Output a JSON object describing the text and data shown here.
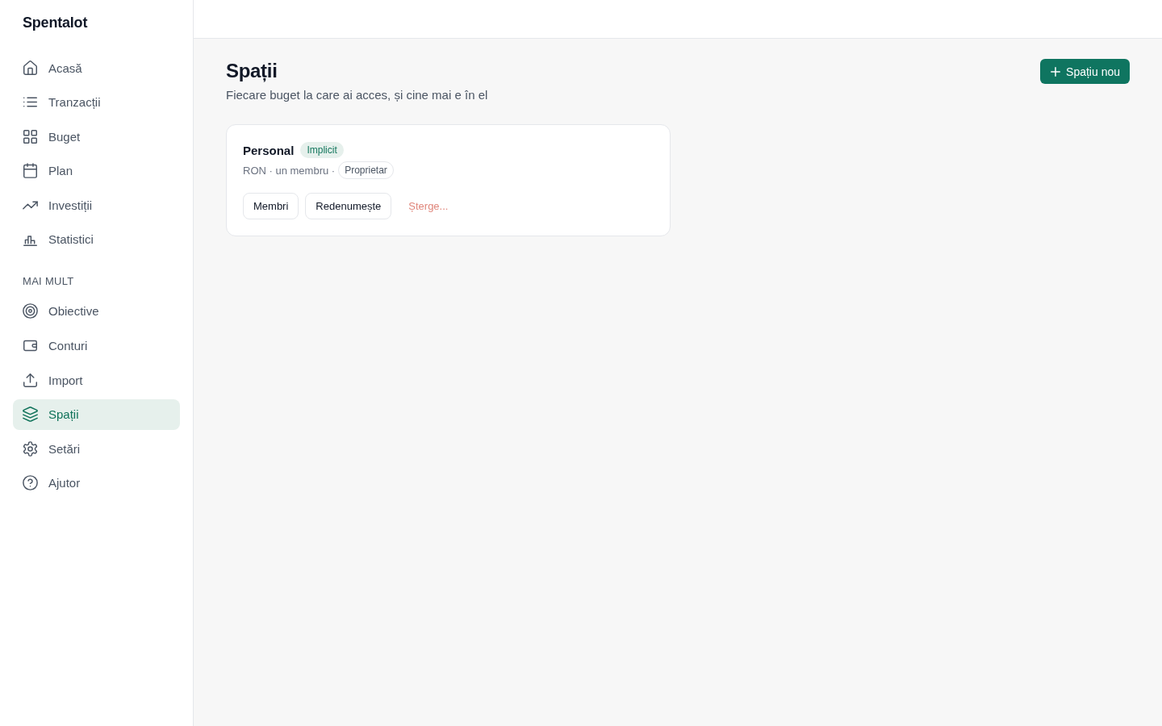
{
  "sidebar": {
    "brand": "Spentalot",
    "items": [
      {
        "label": "Acasă",
        "selected": false
      },
      {
        "label": "Tranzacții",
        "selected": false
      },
      {
        "label": "Buget",
        "selected": false
      },
      {
        "label": "Plan",
        "selected": false
      },
      {
        "label": "Investiții",
        "selected": false
      },
      {
        "label": "Statistici",
        "selected": false
      }
    ],
    "section": {
      "title": "MAI MULT",
      "items": [
        {
          "label": "Obiective",
          "selected": false
        },
        {
          "label": "Conturi",
          "selected": false
        },
        {
          "label": "Import",
          "selected": false
        },
        {
          "label": "Spații",
          "selected": true
        },
        {
          "label": "Setări",
          "selected": false
        },
        {
          "label": "Ajutor",
          "selected": false
        }
      ]
    }
  },
  "page": {
    "title": "Spații",
    "subtitle": "Fiecare buget la care ai acces, și cine mai e în el",
    "new_button": "Spațiu nou"
  },
  "spaces": [
    {
      "name": "Personal",
      "badge": "Implicit",
      "meta": "RON · un membru ·",
      "role": "Proprietar",
      "actions": [
        {
          "label": "Membri",
          "kind": "button"
        },
        {
          "label": "Redenumește",
          "kind": "button"
        },
        {
          "label": "Șterge...",
          "kind": "danger"
        }
      ]
    }
  ]
}
